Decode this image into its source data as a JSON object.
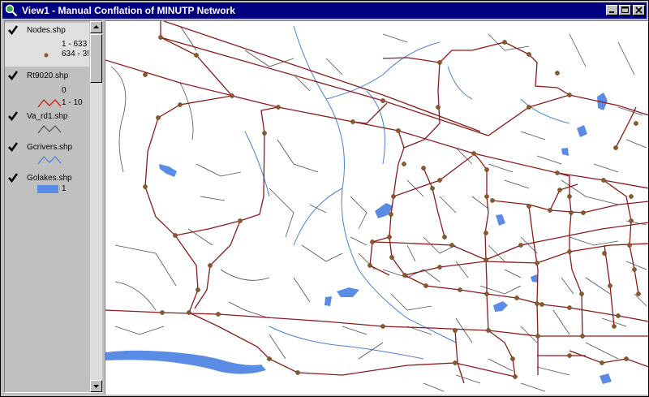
{
  "window": {
    "title": "View1 - Manual Conflation of MINUTP Network"
  },
  "titlebar_buttons": [
    "minimize",
    "maximize",
    "close"
  ],
  "toc": {
    "layers": [
      {
        "name": "Nodes.shp",
        "checked": true,
        "selected": true,
        "legend": [
          {
            "label": "1 - 633",
            "symbol": "none"
          },
          {
            "label": "634 - 3!",
            "symbol": "dot"
          }
        ]
      },
      {
        "name": "Rt9020.shp",
        "checked": true,
        "selected": false,
        "legend": [
          {
            "label": "0",
            "symbol": "none"
          },
          {
            "label": "1 - 10",
            "symbol": "red-line"
          }
        ]
      },
      {
        "name": "Va_rd1.shp",
        "checked": true,
        "selected": false,
        "legend": [
          {
            "label": "",
            "symbol": "dark-line"
          }
        ]
      },
      {
        "name": "Gcrivers.shp",
        "checked": true,
        "selected": false,
        "legend": [
          {
            "label": "",
            "symbol": "blue-line"
          }
        ]
      },
      {
        "name": "Golakes.shp",
        "checked": true,
        "selected": false,
        "legend": [
          {
            "label": "1",
            "symbol": "blue-fill"
          }
        ]
      }
    ]
  },
  "colors": {
    "network": "#8b1a1a",
    "node": "#8b5a2b",
    "road": "#505050",
    "river": "#4a7fd6",
    "lake": "#5a8ce6",
    "titlebar": "#000080"
  }
}
